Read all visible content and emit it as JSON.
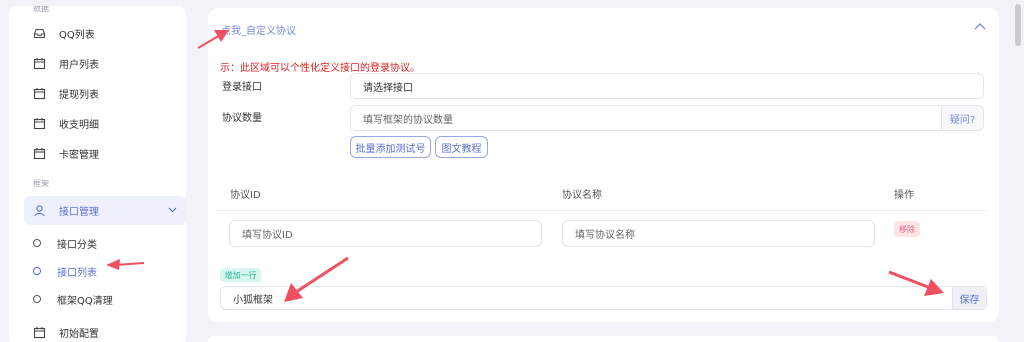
{
  "sidebar": {
    "top_section_label": "数据",
    "items": [
      {
        "label": "QQ列表",
        "icon": "inbox-icon"
      },
      {
        "label": "用户列表",
        "icon": "calendar-icon"
      },
      {
        "label": "提现列表",
        "icon": "calendar-icon"
      },
      {
        "label": "收支明细",
        "icon": "calendar-icon"
      },
      {
        "label": "卡密管理",
        "icon": "calendar-icon"
      }
    ],
    "section_label": "框架",
    "group": {
      "label": "接口管理",
      "icon": "user-icon"
    },
    "sub_items": [
      {
        "label": "接口分类"
      },
      {
        "label": "接口列表"
      },
      {
        "label": "框架QQ清理"
      }
    ],
    "bottom_item": {
      "label": "初始配置",
      "icon": "calendar-icon"
    }
  },
  "panel": {
    "title": "点我_自定义协议",
    "notice": "示：此区域可以个性化定义接口的登录协议。",
    "login_label": "登录接口",
    "login_value": "请选择接口",
    "count_label": "协议数量",
    "count_placeholder": "填写框架的协议数量",
    "count_suffix": "疑问?",
    "batch_button": "批量添加测试号",
    "tutorial_button": "图文教程",
    "table": {
      "headers": [
        "协议ID",
        "协议名称",
        "操作"
      ],
      "row": {
        "id_placeholder": "填写协议ID",
        "name_placeholder": "填写协议名称",
        "remove_label": "移除"
      }
    },
    "add_row_label": "增加一行",
    "framework_value": "小狐框架",
    "save_label": "保存"
  },
  "colors": {
    "accent": "#5a6fd6",
    "notice": "#e02020",
    "arrow": "#f05060",
    "remove": "#e86b7f",
    "add": "#22b59a"
  }
}
